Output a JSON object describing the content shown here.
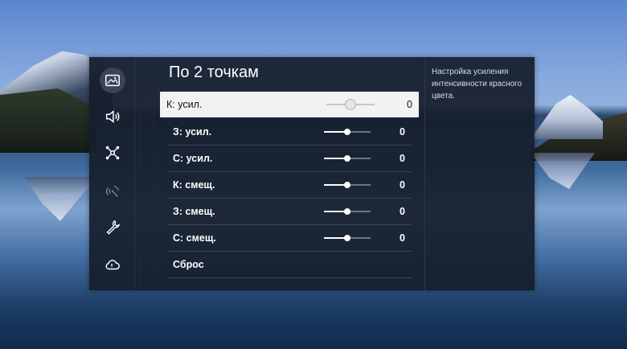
{
  "sidebar": {
    "items": [
      {
        "icon": "picture-icon",
        "active": true
      },
      {
        "icon": "sound-icon",
        "active": false
      },
      {
        "icon": "network-icon",
        "active": false
      },
      {
        "icon": "broadcast-icon",
        "active": false
      },
      {
        "icon": "wrench-icon",
        "active": false
      },
      {
        "icon": "support-cloud-icon",
        "active": false
      }
    ]
  },
  "main": {
    "title": "По 2 точкам",
    "rows": [
      {
        "label": "К: усил.",
        "value": "0",
        "slider_fraction": 0.5,
        "focused": true
      },
      {
        "label": "З: усил.",
        "value": "0",
        "slider_fraction": 0.5
      },
      {
        "label": "С: усил.",
        "value": "0",
        "slider_fraction": 0.5
      },
      {
        "label": "К: смещ.",
        "value": "0",
        "slider_fraction": 0.5
      },
      {
        "label": "З: смещ.",
        "value": "0",
        "slider_fraction": 0.5
      },
      {
        "label": "С: смещ.",
        "value": "0",
        "slider_fraction": 0.5
      },
      {
        "label": "Сброс"
      }
    ]
  },
  "help": {
    "text": "Настройка усиления интенсивности красного цвета."
  },
  "colors": {
    "panel_bg": "#161e2c",
    "focus_bg": "#f2f2f2",
    "text": "#ffffff"
  }
}
